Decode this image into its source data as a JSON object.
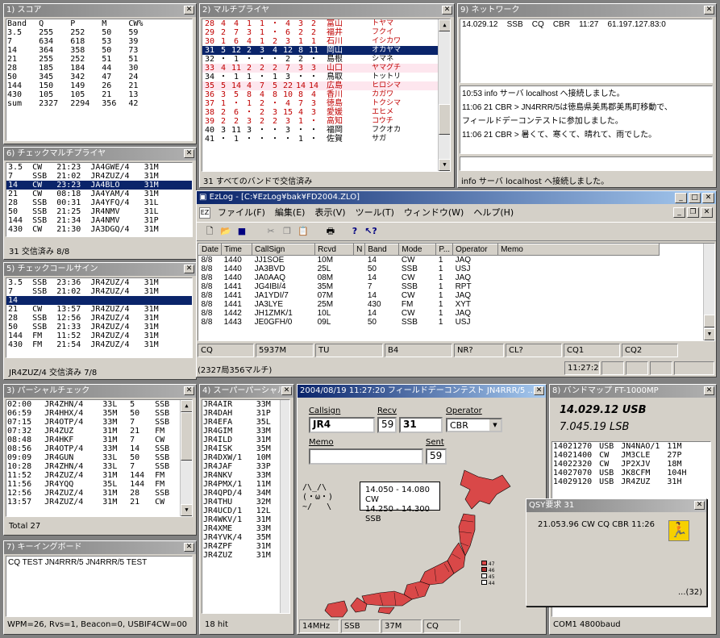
{
  "score": {
    "title": "1) スコア",
    "cols": [
      "Band",
      "Q",
      "P",
      "M",
      "CW%"
    ],
    "rows": [
      [
        "3.5",
        "255",
        "252",
        "50",
        "59"
      ],
      [
        "7",
        "634",
        "618",
        "53",
        "39"
      ],
      [
        "14",
        "364",
        "358",
        "50",
        "73"
      ],
      [
        "21",
        "255",
        "252",
        "51",
        "51"
      ],
      [
        "28",
        "185",
        "184",
        "44",
        "30"
      ],
      [
        "50",
        "345",
        "342",
        "47",
        "24"
      ],
      [
        "144",
        "150",
        "149",
        "26",
        "21"
      ],
      [
        "430",
        "105",
        "105",
        "21",
        "13"
      ],
      [
        "sum",
        "2327",
        "2294",
        "356",
        "42"
      ]
    ]
  },
  "multi": {
    "title": "2) マルチプライヤ",
    "rows": [
      {
        "c": [
          "28",
          "4",
          "4",
          "1",
          "1",
          "・",
          "4",
          "3",
          "2"
        ],
        "jp": "富山",
        "kana": "トヤマ",
        "st": "red"
      },
      {
        "c": [
          "29",
          "2",
          "7",
          "3",
          "1",
          "・",
          "6",
          "2",
          "2"
        ],
        "jp": "福井",
        "kana": "フクイ",
        "st": "red"
      },
      {
        "c": [
          "30",
          "1",
          "6",
          "4",
          "1",
          "2",
          "3",
          "1",
          "1"
        ],
        "jp": "石川",
        "kana": "イシカワ",
        "st": "red"
      },
      {
        "c": [
          "31",
          "5",
          "12",
          "2",
          "3",
          "4",
          "12",
          "8",
          "11"
        ],
        "jp": "岡山",
        "kana": "オカヤマ",
        "st": "sel"
      },
      {
        "c": [
          "32",
          "・",
          "1",
          "・",
          "・",
          "・",
          "2",
          "2",
          "・"
        ],
        "jp": "島根",
        "kana": "シマネ",
        "st": ""
      },
      {
        "c": [
          "33",
          "4",
          "11",
          "2",
          "2",
          "2",
          "7",
          "3",
          "3"
        ],
        "jp": "山口",
        "kana": "ヤマグチ",
        "st": "redpink"
      },
      {
        "c": [
          "34",
          "・",
          "1",
          "1",
          "・",
          "1",
          "3",
          "・",
          "・"
        ],
        "jp": "鳥取",
        "kana": "トットリ",
        "st": ""
      },
      {
        "c": [
          "35",
          "5",
          "14",
          "4",
          "7",
          "5",
          "22",
          "14",
          "14"
        ],
        "jp": "広島",
        "kana": "ヒロシマ",
        "st": "redpink"
      },
      {
        "c": [
          "36",
          "3",
          "5",
          "8",
          "4",
          "8",
          "10",
          "8",
          "4"
        ],
        "jp": "香川",
        "kana": "カガワ",
        "st": "red"
      },
      {
        "c": [
          "37",
          "1",
          "・",
          "1",
          "2",
          "・",
          "4",
          "7",
          "3"
        ],
        "jp": "徳島",
        "kana": "トクシマ",
        "st": "red"
      },
      {
        "c": [
          "38",
          "2",
          "6",
          "・",
          "2",
          "3",
          "15",
          "4",
          "3"
        ],
        "jp": "愛媛",
        "kana": "エヒメ",
        "st": "red"
      },
      {
        "c": [
          "39",
          "2",
          "2",
          "3",
          "2",
          "2",
          "3",
          "1",
          "・"
        ],
        "jp": "高知",
        "kana": "コウチ",
        "st": "red"
      },
      {
        "c": [
          "40",
          "3",
          "11",
          "3",
          "・",
          "・",
          "3",
          "・",
          "・"
        ],
        "jp": "福岡",
        "kana": "フクオカ",
        "st": ""
      },
      {
        "c": [
          "41",
          "・",
          "1",
          "・",
          "・",
          "・",
          "・",
          "1",
          "・"
        ],
        "jp": "佐賀",
        "kana": "サガ",
        "st": ""
      }
    ],
    "footer": "31 すべてのバンドで交信済み"
  },
  "network": {
    "title": "9) ネットワーク",
    "spot": "14.029.12    SSB    CQ    CBR    11:27    61.197.127.83:0",
    "log": [
      "10:53 info サーバ localhost へ接続しました。",
      "11:06 21 CBR > JN4RRR/5は徳島県美馬郡美馬町移動で、",
      "フィールドデーコンテストに参加しました。",
      "11:06 21 CBR > 暑くて、寒くて、晴れて、雨でした。"
    ],
    "status": "info サーバ localhost へ接続しました。"
  },
  "checkmulti": {
    "title": "6) チェックマルチプライヤ",
    "rows": [
      [
        "3.5",
        "CW",
        "21:23",
        "JA4GWE/4",
        "31M"
      ],
      [
        "7",
        "SSB",
        "21:02",
        "JR4ZUZ/4",
        "31M"
      ],
      [
        "14",
        "CW",
        "23:23",
        "JA4BLO",
        "31M"
      ],
      [
        "21",
        "CW",
        "08:18",
        "JA4YAM/4",
        "31M"
      ],
      [
        "28",
        "SSB",
        "00:31",
        "JA4YFQ/4",
        "31L"
      ],
      [
        "50",
        "SSB",
        "21:25",
        "JR4NMV",
        "31L"
      ],
      [
        "144",
        "SSB",
        "21:34",
        "JA4NMV",
        "31P"
      ],
      [
        "430",
        "CW",
        "21:30",
        "JA3DGQ/4",
        "31M"
      ]
    ],
    "sel": 2,
    "footer": "31 交信済み 8/8"
  },
  "checkcall": {
    "title": "5) チェックコールサイン",
    "rows": [
      [
        "3.5",
        "SSB",
        "23:36",
        "JR4ZUZ/4",
        "31M"
      ],
      [
        "7",
        "SSB",
        "21:02",
        "JR4ZUZ/4",
        "31M"
      ],
      [
        "14",
        "",
        "",
        "",
        ""
      ],
      [
        "21",
        "CW",
        "13:57",
        "JR4ZUZ/4",
        "31M"
      ],
      [
        "28",
        "SSB",
        "12:56",
        "JR4ZUZ/4",
        "31M"
      ],
      [
        "50",
        "SSB",
        "21:33",
        "JR4ZUZ/4",
        "31M"
      ],
      [
        "144",
        "FM",
        "11:52",
        "JR4ZUZ/4",
        "31M"
      ],
      [
        "430",
        "FM",
        "21:54",
        "JR4ZUZ/4",
        "31M"
      ]
    ],
    "sel": 2,
    "footer": "JR4ZUZ/4 交信済み 7/8"
  },
  "main": {
    "title": "EzLog - [C:¥EzLog¥bak¥FD2004.ZLO]",
    "menu": [
      "ファイル(F)",
      "編集(E)",
      "表示(V)",
      "ツール(T)",
      "ウィンドウ(W)",
      "ヘルプ(H)"
    ],
    "cols": [
      "Date",
      "Time",
      "CallSign",
      "Rcvd",
      "N",
      "Band",
      "Mode",
      "P...",
      "Operator",
      "Memo"
    ],
    "rows": [
      [
        "8/8",
        "1440",
        "JJ1SOE",
        "10M",
        "",
        "14",
        "CW",
        "1",
        "JAQ",
        ""
      ],
      [
        "8/8",
        "1440",
        "JA3BVD",
        "25L",
        "",
        "50",
        "SSB",
        "1",
        "USJ",
        ""
      ],
      [
        "8/8",
        "1440",
        "JA0AAQ",
        "08M",
        "",
        "14",
        "CW",
        "1",
        "JAQ",
        ""
      ],
      [
        "8/8",
        "1441",
        "JG4IBI/4",
        "35M",
        "",
        "7",
        "SSB",
        "1",
        "RPT",
        ""
      ],
      [
        "8/8",
        "1441",
        "JA1YDI/7",
        "07M",
        "",
        "14",
        "CW",
        "1",
        "JAQ",
        ""
      ],
      [
        "8/8",
        "1441",
        "JA3LYE",
        "25M",
        "",
        "430",
        "FM",
        "1",
        "XYT",
        ""
      ],
      [
        "8/8",
        "1442",
        "JH1ZMK/1",
        "10L",
        "",
        "14",
        "CW",
        "1",
        "JAQ",
        ""
      ],
      [
        "8/8",
        "1443",
        "JE0GFH/0",
        "09L",
        "",
        "50",
        "SSB",
        "1",
        "USJ",
        ""
      ]
    ],
    "status": [
      "CQ",
      "5937M",
      "TU",
      "B4",
      "NR?",
      "CL?",
      "CQ1",
      "CQ2"
    ],
    "status2": "(2327局356マルチ)",
    "time": "11:27:20"
  },
  "partial": {
    "title": "3) パーシャルチェック",
    "rows": [
      [
        "02:00",
        "JR4ZHN/4",
        "33L",
        "5",
        "SSB"
      ],
      [
        "06:59",
        "JR4HHX/4",
        "35M",
        "50",
        "SSB"
      ],
      [
        "07:15",
        "JR4OTP/4",
        "33M",
        "7",
        "SSB"
      ],
      [
        "07:32",
        "JR4ZUZ",
        "31M",
        "21",
        "FM"
      ],
      [
        "08:48",
        "JR4HKF",
        "31M",
        "7",
        "CW"
      ],
      [
        "08:56",
        "JR4OTP/4",
        "33M",
        "14",
        "SSB"
      ],
      [
        "09:09",
        "JR4GUN",
        "33L",
        "50",
        "SSB"
      ],
      [
        "10:28",
        "JR4ZHN/4",
        "33L",
        "7",
        "SSB"
      ],
      [
        "11:52",
        "JR4ZUZ/4",
        "31M",
        "144",
        "FM"
      ],
      [
        "11:56",
        "JR4YQQ",
        "35L",
        "144",
        "FM"
      ],
      [
        "12:56",
        "JR4ZUZ/4",
        "31M",
        "28",
        "SSB"
      ],
      [
        "13:57",
        "JR4ZUZ/4",
        "31M",
        "21",
        "CW"
      ]
    ],
    "footer": "Total 27"
  },
  "superp": {
    "title": "4) スーパーパーシャル",
    "rows": [
      [
        "JR4AIR",
        "33M"
      ],
      [
        "JR4DAH",
        "31P"
      ],
      [
        "JR4EFA",
        "35L"
      ],
      [
        "JR4GIM",
        "33M"
      ],
      [
        "JR4ILD",
        "31M"
      ],
      [
        "JR4ISK",
        "35M"
      ],
      [
        "JR4DXW/1",
        "10M"
      ],
      [
        "JR4JAF",
        "33P"
      ],
      [
        "JR4NKV",
        "33M"
      ],
      [
        "JR4PMX/1",
        "11M"
      ],
      [
        "JR4QPD/4",
        "34M"
      ],
      [
        "JR4THU",
        "32M"
      ],
      [
        "JR4UCD/1",
        "12L"
      ],
      [
        "JR4WKV/1",
        "31M"
      ],
      [
        "JR4XME",
        "33M"
      ],
      [
        "JR4YVK/4",
        "35M"
      ],
      [
        "JR4ZPF",
        "31M"
      ],
      [
        "JR4ZUZ",
        "31M"
      ]
    ],
    "footer": "18 hit"
  },
  "keying": {
    "title": "7) キーイングボード",
    "text": "CQ TEST JN4RRR/5 JN4RRR/5 TEST",
    "footer": "WPM=26, Rvs=1, Beacon=0, USBIF4CW=00"
  },
  "entry": {
    "title": "2004/08/19 11:27:20 フィールドデーコンテスト JN4RRR/5 ...",
    "labels": {
      "callsign": "Callsign",
      "recv": "Recv",
      "operator": "Operator",
      "memo": "Memo",
      "sent": "Sent"
    },
    "callsign": "JR4",
    "recv1": "59",
    "recv2": "31",
    "operator": "CBR",
    "sent": "59",
    "face": "/\\_/\\\n(・ω・)\n~/   \\",
    "bubble": [
      "14.050 - 14.080 CW",
      "14.250 - 14.300 SSB"
    ],
    "legend": [
      "47",
      "46",
      "45",
      "44"
    ],
    "status": [
      "14MHz",
      "SSB",
      "37M",
      "CQ"
    ]
  },
  "bandmap": {
    "title": "8) バンドマップ FT-1000MP",
    "freq": "14.029.12 USB",
    "freq2": "7.045.19 LSB",
    "rows": [
      [
        "14021270",
        "USB",
        "JN4NAO/1",
        "11M"
      ],
      [
        "14021400",
        "CW",
        "JM3CLE",
        "27P"
      ],
      [
        "14022320",
        "CW",
        "JP2XJV",
        "18M"
      ],
      [
        "14027070",
        "USB",
        "JK8CFM",
        "104H"
      ],
      [
        "14029120",
        "USB",
        "JR4ZUZ",
        "31H"
      ]
    ],
    "footer": "COM1 4800baud"
  },
  "qsy": {
    "title": "QSY要求 31",
    "text": "21.053.96 CW CQ CBR 11:26",
    "count": "...(32)"
  },
  "colors": {
    "selected": "#0a246a",
    "red": "#c00000",
    "map": "#d94848",
    "title_active": "#0a246a"
  }
}
